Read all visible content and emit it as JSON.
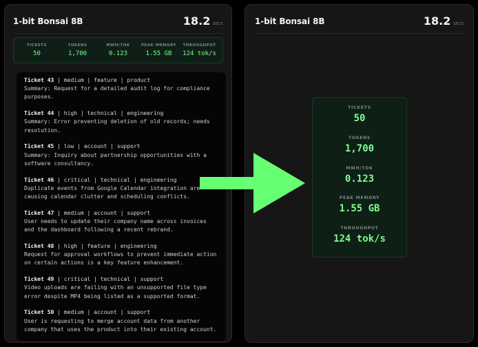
{
  "left_panel": {
    "title": "1-bit Bonsai 8B",
    "timer_value": "18.2",
    "timer_unit": "SECS",
    "stats": [
      {
        "label": "TICKETS",
        "value": "50"
      },
      {
        "label": "TOKENS",
        "value": "1,700"
      },
      {
        "label": "MWH/TOK",
        "value": "0.123"
      },
      {
        "label": "PEAK MEMORY",
        "value": "1.55 GB"
      },
      {
        "label": "THROUGHPUT",
        "value": "124 tok/s"
      }
    ],
    "tickets": [
      {
        "id": "Ticket 43",
        "meta": " | medium | feature | product",
        "body": "Summary: Request for a detailed audit log for compliance purposes."
      },
      {
        "id": "Ticket 44",
        "meta": " | high | technical | engineering",
        "body": "Summary: Error preventing deletion of old records; needs resolution."
      },
      {
        "id": "Ticket 45",
        "meta": " | low | account | support",
        "body": "Summary: Inquiry about partnership opportunities with a software consultancy."
      },
      {
        "id": "Ticket 46",
        "meta": " | critical | technical | engineering",
        "body": "Duplicate events from Google Calendar integration are causing calendar clutter and scheduling conflicts."
      },
      {
        "id": "Ticket 47",
        "meta": " | medium | account | support",
        "body": "User needs to update their company name across invoices and the dashboard following a recent rebrand."
      },
      {
        "id": "Ticket 48",
        "meta": " | high | feature | engineering",
        "body": "Request for approval workflows to prevent immediate action on certain actions is a key feature enhancement."
      },
      {
        "id": "Ticket 49",
        "meta": " | critical | technical | support",
        "body": "Video uploads are failing with an unsupported file type error despite MP4 being listed as a supported format."
      },
      {
        "id": "Ticket 50",
        "meta": " | medium | account | support",
        "body": "User is requesting to merge account data from another company that uses the product into their existing account."
      }
    ]
  },
  "right_panel": {
    "title": "1-bit Bonsai 8B",
    "timer_value": "18.2",
    "timer_unit": "SECS",
    "metrics": [
      {
        "label": "TICKETS",
        "value": "50"
      },
      {
        "label": "TOKENS",
        "value": "1,700"
      },
      {
        "label": "MWH/TOK",
        "value": "0.123"
      },
      {
        "label": "PEAK MEMORY",
        "value": "1.55 GB"
      },
      {
        "label": "THROUGHPUT",
        "value": "124 tok/s"
      }
    ]
  },
  "colors": {
    "accent_green": "#7dff8d",
    "arrow_green": "#66ff73",
    "panel_bg": "#161616"
  },
  "icons": {
    "arrow": "arrow-right-icon"
  }
}
